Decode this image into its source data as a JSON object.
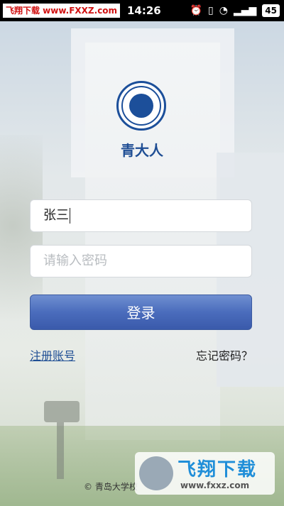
{
  "status_bar": {
    "brand_banner": "飞翔下载 www.FXXZ.com",
    "time": "14:26",
    "battery_level": "45",
    "icons": [
      "alarm-icon",
      "vibrate-icon",
      "wifi-icon",
      "signal-icon",
      "battery-icon"
    ]
  },
  "app": {
    "name": "青大人"
  },
  "login_form": {
    "username_value": "张三",
    "password_placeholder": "请输入密码",
    "login_label": "登录",
    "register_label": "注册账号",
    "forgot_label": "忘记密码？"
  },
  "footer": {
    "copyright": "© 青岛大学校"
  },
  "watermark": {
    "text": "飞翔下载",
    "url": "www.fxxz.com"
  },
  "colors": {
    "brand_blue": "#1f4e94",
    "button_blue": "#4a6cbc"
  }
}
